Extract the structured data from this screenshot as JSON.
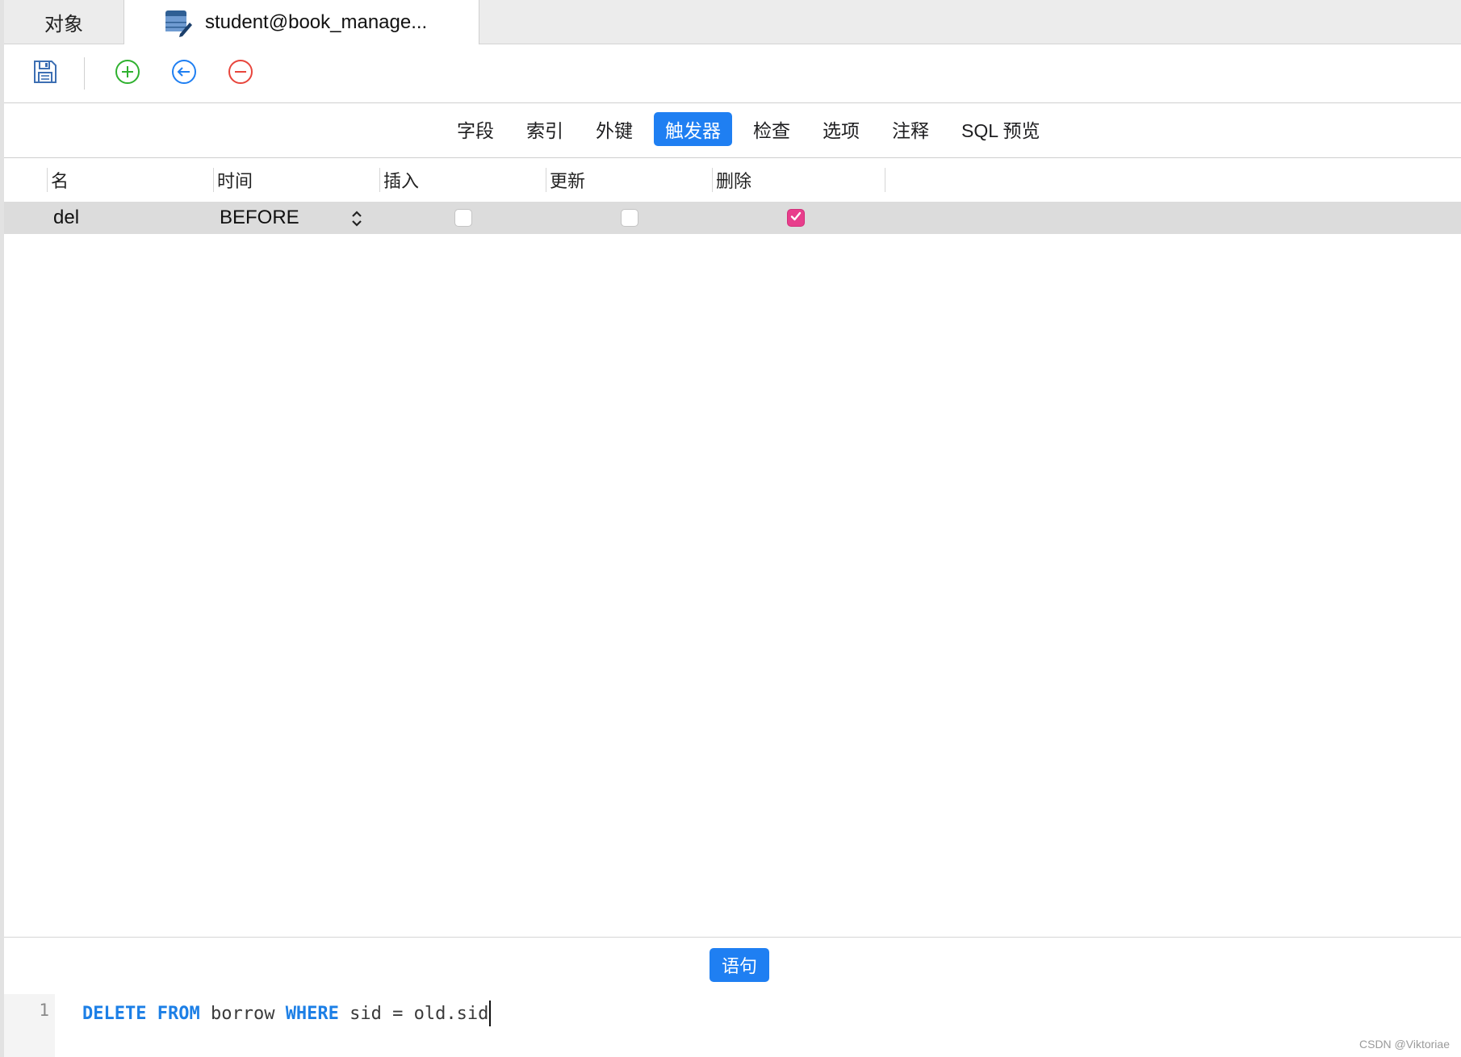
{
  "tabs": {
    "objects_label": "对象",
    "active_label": "student@book_manage..."
  },
  "toolbar": {
    "save_icon": "save-icon",
    "add_icon": "add-circle-icon",
    "insert_before_icon": "arrow-left-circle-icon",
    "delete_icon": "minus-circle-icon",
    "add_color": "#2fb12f",
    "insert_color": "#1f7ff2",
    "delete_color": "#e8453c"
  },
  "segments": [
    {
      "label": "字段",
      "active": false
    },
    {
      "label": "索引",
      "active": false
    },
    {
      "label": "外键",
      "active": false
    },
    {
      "label": "触发器",
      "active": true
    },
    {
      "label": "检查",
      "active": false
    },
    {
      "label": "选项",
      "active": false
    },
    {
      "label": "注释",
      "active": false
    },
    {
      "label": "SQL 预览",
      "active": false
    }
  ],
  "accent_color": "#1f7ff2",
  "table": {
    "columns": [
      "名",
      "时间",
      "插入",
      "更新",
      "删除"
    ],
    "rows": [
      {
        "name": "del",
        "time": "BEFORE",
        "insert": false,
        "update": false,
        "delete": true
      }
    ]
  },
  "statement": {
    "button_label": "语句",
    "line_number": "1",
    "code_tokens": [
      {
        "text": "DELETE",
        "kw": true
      },
      {
        "text": " ",
        "kw": false
      },
      {
        "text": "FROM",
        "kw": true
      },
      {
        "text": " borrow ",
        "kw": false
      },
      {
        "text": "WHERE",
        "kw": true
      },
      {
        "text": " sid = old.sid",
        "kw": false
      }
    ]
  },
  "watermark": "CSDN @Viktoriae"
}
